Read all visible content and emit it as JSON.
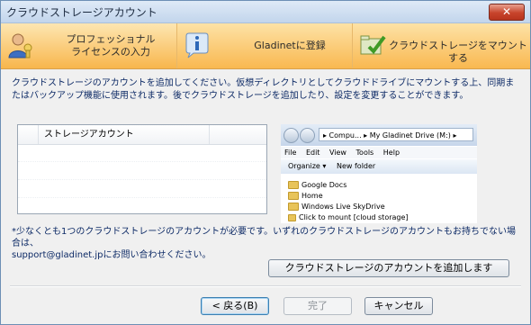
{
  "window": {
    "title": "クラウドストレージアカウント",
    "close_label": "✕"
  },
  "steps": [
    {
      "label_line1": "プロフェッショナル",
      "label_line2": "ライセンスの入力"
    },
    {
      "label": "Gladinetに登録"
    },
    {
      "label": "クラウドストレージをマウントする"
    }
  ],
  "description": "クラウドストレージのアカウントを追加してください。仮想ディレクトリとしてクラウドドライブにマウントする上、同期またはバックアップ機能に使用されます。後でクラウドストレージを追加したり、設定を変更することができます。",
  "account_list": {
    "column_header": "ストレージアカウント"
  },
  "explorer_preview": {
    "address": "▸ Compu... ▸ My Gladinet Drive (M:) ▸",
    "menu": [
      "File",
      "Edit",
      "View",
      "Tools",
      "Help"
    ],
    "toolbar_organize": "Organize ▾",
    "toolbar_new_folder": "New folder",
    "items": [
      "Google Docs",
      "Home",
      "Windows Live SkyDrive",
      "Click to mount [cloud storage]"
    ]
  },
  "note_line1": "*少なくとも1つのクラウドストレージのアカウントが必要です。いずれのクラウドストレージのアカウントもお持ちでない場合は、",
  "note_line2": "support@gladinet.jpにお問い合わせください。",
  "buttons": {
    "add_account": "クラウドストレージのアカウントを追加します",
    "back": "< 戻る(B)",
    "finish": "完了",
    "cancel": "キャンセル"
  }
}
